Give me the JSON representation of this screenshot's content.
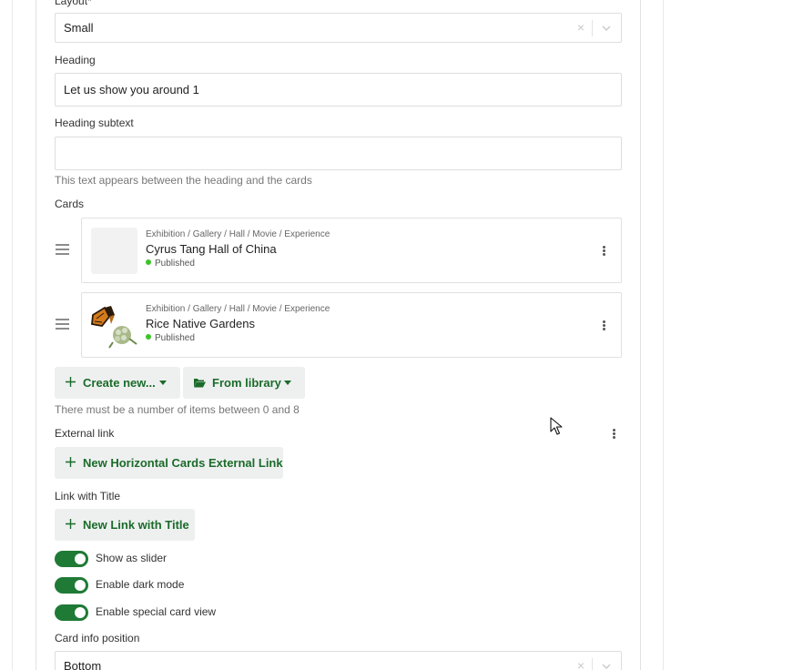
{
  "fields": {
    "layout": {
      "label": "Layout",
      "required_marker": "*",
      "value": "Small",
      "clear_glyph": "×"
    },
    "heading": {
      "label": "Heading",
      "value": "Let us show you around 1"
    },
    "heading_subtext": {
      "label": "Heading subtext",
      "value": "",
      "help": "This text appears between the heading and the cards"
    },
    "cards": {
      "label": "Cards",
      "items": [
        {
          "type": "Exhibition / Gallery / Hall / Movie / Experience",
          "title": "Cyrus Tang Hall of China",
          "status": "Published",
          "has_image": false
        },
        {
          "type": "Exhibition / Gallery / Hall / Movie / Experience",
          "title": "Rice Native Gardens",
          "status": "Published",
          "has_image": true
        }
      ],
      "create_new_label": "Create new...",
      "from_library_label": "From library",
      "help": "There must be a number of items between 0 and 8"
    },
    "external_link": {
      "label": "External link",
      "button_label": "New Horizontal Cards External Link"
    },
    "link_with_title": {
      "label": "Link with Title",
      "button_label": "New Link with Title"
    },
    "toggles": [
      {
        "label": "Show as slider",
        "on": true
      },
      {
        "label": "Enable dark mode",
        "on": true
      },
      {
        "label": "Enable special card view",
        "on": true
      }
    ],
    "card_info_position": {
      "label": "Card info position",
      "value": "Bottom",
      "clear_glyph": "×"
    }
  },
  "colors": {
    "accent_green": "#1b6b2a",
    "toggle_on": "#1f7a35",
    "published_dot": "#3ec22a",
    "button_bg": "#eef0f0"
  },
  "icons": {
    "drag": "drag-handle-icon",
    "more": "kebab-menu-icon",
    "plus": "plus-icon",
    "folder": "folder-open-icon",
    "chevron": "chevron-down-icon"
  }
}
